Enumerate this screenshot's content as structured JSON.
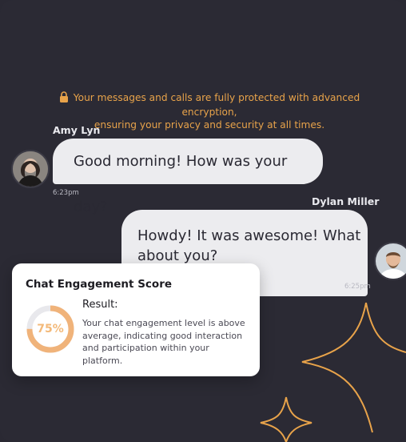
{
  "notice": {
    "icon": "lock-icon",
    "line1": "Your messages and calls are fully protected with advanced encryption,",
    "line2": "ensuring your privacy and security at all times."
  },
  "messages": [
    {
      "sender": "Amy Lyn",
      "text": "Good morning! How was your day?",
      "time": "6:23pm"
    },
    {
      "sender": "Dylan Miller",
      "text_line1": "Howdy! It was awesome! What",
      "text_line2": "about you?",
      "time": "6:25pm"
    }
  ],
  "engagement": {
    "title": "Chat Engagement Score",
    "score_label": "75%",
    "score_fraction": 0.75,
    "result_label": "Result:",
    "result_text": "Your chat engagement level is above average, indicating good interaction and participation within your platform."
  },
  "colors": {
    "background": "#2b2a34",
    "accent": "#e8a34a",
    "bubble": "#ececef"
  }
}
